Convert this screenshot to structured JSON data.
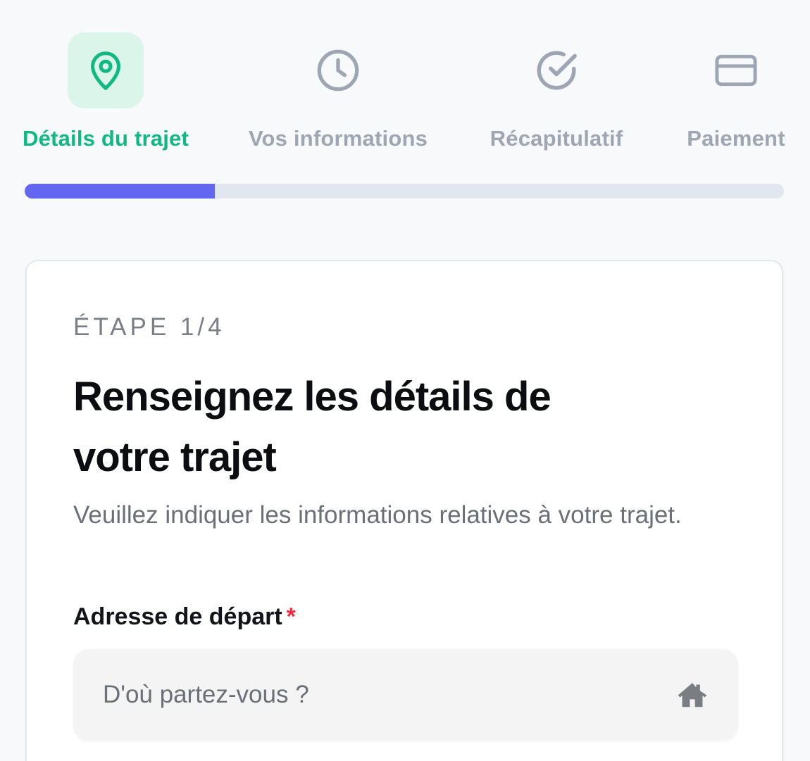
{
  "stepper": {
    "steps": [
      {
        "label": "Détails du trajet",
        "icon": "map-pin-icon",
        "active": true
      },
      {
        "label": "Vos informations",
        "icon": "clock-icon",
        "active": false
      },
      {
        "label": "Récapitulatif",
        "icon": "check-circle-icon",
        "active": false
      },
      {
        "label": "Paiement",
        "icon": "credit-card-icon",
        "active": false
      }
    ],
    "progress_fraction": 0.25
  },
  "colors": {
    "accent_green": "#10b981",
    "accent_green_bg": "#dcf5eb",
    "progress_fill": "#6366f1",
    "inactive": "#9ea6b3",
    "required": "#ef2b3f"
  },
  "card": {
    "kicker": "ÉTAPE 1/4",
    "title": "Renseignez les détails de votre trajet",
    "subtitle": "Veuillez indiquer les informations relatives à votre trajet.",
    "departure": {
      "label": "Adresse de départ",
      "required_mark": "*",
      "placeholder": "D'où partez-vous ?",
      "icon": "home-icon"
    }
  }
}
